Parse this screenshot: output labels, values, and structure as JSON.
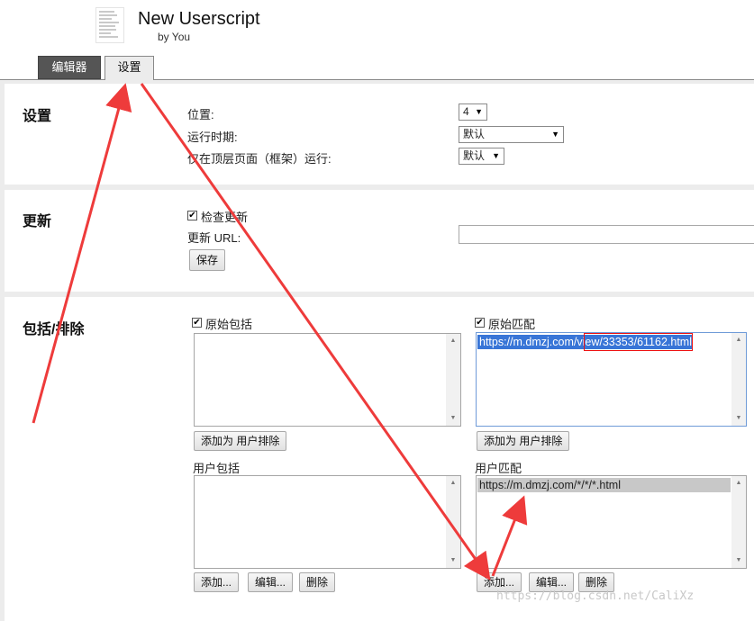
{
  "header": {
    "title": "New Userscript",
    "byline": "by You",
    "logo_icon": "script-file-icon"
  },
  "tabs": [
    {
      "label": "编辑器",
      "active": false
    },
    {
      "label": "设置",
      "active": true
    }
  ],
  "settings": {
    "title": "设置",
    "position_label": "位置:",
    "position_value": "4",
    "runat_label": "运行时期:",
    "runat_value": "默认",
    "topframe_label": "仅在顶层页面（框架）运行:",
    "topframe_value": "默认"
  },
  "update": {
    "title": "更新",
    "check_label": "检查更新",
    "check_checked": true,
    "url_label": "更新 URL:",
    "url_value": "",
    "save_label": "保存"
  },
  "include": {
    "title": "包括/排除",
    "orig_include_label": "原始包括",
    "orig_include_checked": true,
    "orig_include_items": [],
    "orig_match_label": "原始匹配",
    "orig_match_checked": true,
    "orig_match_items": [
      "https://m.dmzj.com/view/33353/61162.html"
    ],
    "add_user_exclude_label": "添加为 用户排除",
    "user_include_label": "用户包括",
    "user_include_items": [],
    "user_match_label": "用户匹配",
    "user_match_items": [
      "https://m.dmzj.com/*/*/*.html"
    ],
    "add_label": "添加...",
    "edit_label": "编辑...",
    "delete_label": "删除"
  },
  "watermark": "https://blog.csdn.net/CaliXz",
  "colors": {
    "annotation_red": "#ee3b3b",
    "selection_blue": "#3875d7",
    "tab_dark": "#555555"
  }
}
